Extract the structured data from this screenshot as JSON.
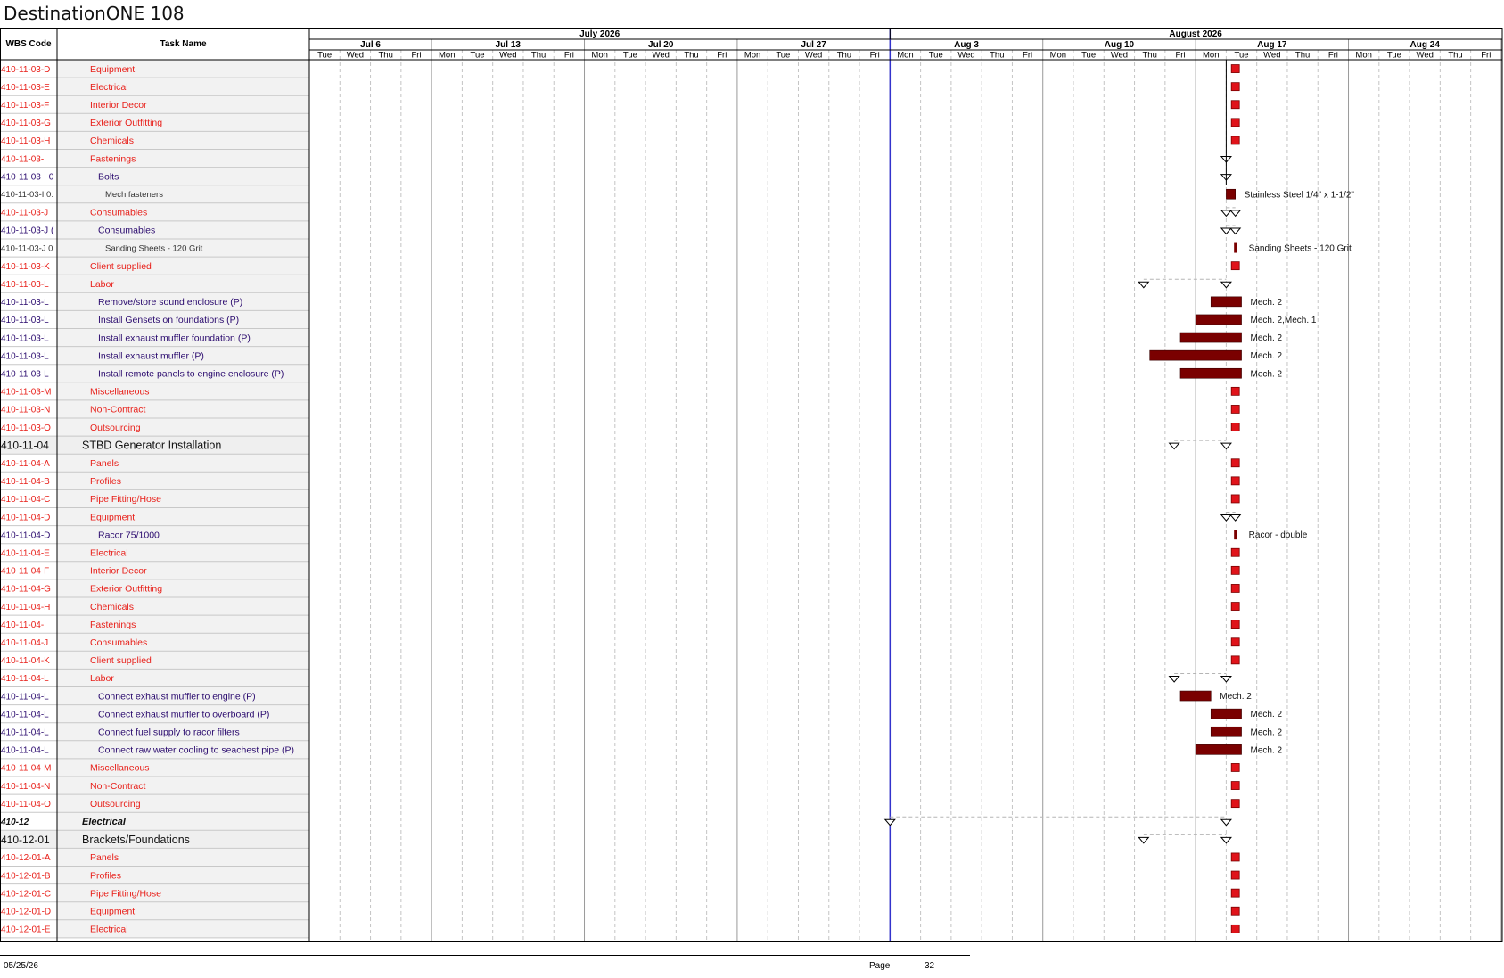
{
  "title": "DestinationONE 108",
  "headers": {
    "wbs": "WBS Code",
    "task": "Task Name"
  },
  "timeline": {
    "months": [
      {
        "label": "July 2026"
      },
      {
        "label": "August 2026"
      }
    ],
    "weeks": [
      "Jul 6",
      "Jul 13",
      "Jul 20",
      "Jul 27",
      "Aug 3",
      "Aug 10",
      "Aug 17",
      "Aug 24"
    ],
    "day_labels": [
      "Tue",
      "Wed",
      "Thu",
      "Fri",
      "Mon",
      "Tue",
      "Wed",
      "Thu",
      "Fri",
      "Mon",
      "Tue",
      "Wed",
      "Thu",
      "Fri",
      "Mon",
      "Tue",
      "Wed",
      "Thu",
      "Fri",
      "Mon",
      "Tue",
      "Wed",
      "Thu",
      "Fri",
      "Mon",
      "Tue",
      "Wed",
      "Thu",
      "Fri",
      "Mon",
      "Tue",
      "Wed",
      "Thu",
      "Fri",
      "Mon",
      "Tue",
      "Wed",
      "Thu",
      "Fri"
    ],
    "week_day_ranges": [
      [
        0,
        3
      ],
      [
        4,
        8
      ],
      [
        9,
        13
      ],
      [
        14,
        18
      ],
      [
        19,
        23
      ],
      [
        24,
        28
      ],
      [
        29,
        33
      ],
      [
        34,
        38
      ]
    ],
    "status_date_index": 19
  },
  "colors": {
    "red_text": "#e8201a",
    "purple_text": "#2a0a6e",
    "gray_text": "#333333",
    "bar_fill": "#7a0000",
    "milestone_fill": "#e0131a",
    "status_line": "#3333cc",
    "row_band": "#f2f2f2"
  },
  "rows": [
    {
      "wbs": "410-11-03-D",
      "name": "Equipment",
      "style": "red",
      "indent": 1,
      "bar": {
        "kind": "milestone",
        "day": 30.3
      }
    },
    {
      "wbs": "410-11-03-E",
      "name": "Electrical",
      "style": "red",
      "indent": 1,
      "bar": {
        "kind": "milestone",
        "day": 30.3
      }
    },
    {
      "wbs": "410-11-03-F",
      "name": "Interior Decor",
      "style": "red",
      "indent": 1,
      "bar": {
        "kind": "milestone",
        "day": 30.3
      }
    },
    {
      "wbs": "410-11-03-G",
      "name": "Exterior Outfitting",
      "style": "red",
      "indent": 1,
      "bar": {
        "kind": "milestone",
        "day": 30.3
      }
    },
    {
      "wbs": "410-11-03-H",
      "name": "Chemicals",
      "style": "red",
      "indent": 1,
      "bar": {
        "kind": "milestone",
        "day": 30.3
      }
    },
    {
      "wbs": "410-11-03-I",
      "name": "Fastenings",
      "style": "red",
      "indent": 1,
      "bar": {
        "kind": "summary",
        "start": 30,
        "end": 30
      }
    },
    {
      "wbs": "410-11-03-I 0",
      "name": "Bolts",
      "style": "purple",
      "indent": 2,
      "bar": {
        "kind": "summary",
        "start": 30,
        "end": 30
      }
    },
    {
      "wbs": "410-11-03-I 0:",
      "name": "Mech fasteners",
      "style": "gray",
      "indent": 3,
      "bar": {
        "kind": "task",
        "start": 30,
        "end": 30.3,
        "label": "Stainless Steel 1/4\" x 1-1/2\""
      }
    },
    {
      "wbs": "410-11-03-J",
      "name": "Consumables",
      "style": "red",
      "indent": 1,
      "bar": {
        "kind": "summary",
        "start": 30,
        "end": 30.3
      }
    },
    {
      "wbs": "410-11-03-J (",
      "name": "Consumables",
      "style": "purple",
      "indent": 2,
      "bar": {
        "kind": "summary",
        "start": 30,
        "end": 30.3
      }
    },
    {
      "wbs": "410-11-03-J 0",
      "name": "Sanding Sheets - 120 Grit",
      "style": "gray",
      "indent": 3,
      "bar": {
        "kind": "thin",
        "day": 30.3,
        "label": "Sanding Sheets - 120 Grit"
      }
    },
    {
      "wbs": "410-11-03-K",
      "name": "Client supplied",
      "style": "red",
      "indent": 1,
      "bar": {
        "kind": "milestone",
        "day": 30.3
      }
    },
    {
      "wbs": "410-11-03-L",
      "name": "Labor",
      "style": "red",
      "indent": 1,
      "bar": {
        "kind": "summary",
        "start": 27.3,
        "end": 30
      }
    },
    {
      "wbs": "410-11-03-L",
      "name": "Remove/store sound enclosure (P)",
      "style": "purple",
      "indent": 2,
      "bar": {
        "kind": "task",
        "start": 29.5,
        "end": 30.5,
        "label": "Mech. 2"
      }
    },
    {
      "wbs": "410-11-03-L",
      "name": "Install Gensets on foundations (P)",
      "style": "purple",
      "indent": 2,
      "bar": {
        "kind": "task",
        "start": 29,
        "end": 30.5,
        "label": "Mech. 2,Mech. 1"
      }
    },
    {
      "wbs": "410-11-03-L",
      "name": "Install exhaust muffler foundation (P)",
      "style": "purple",
      "indent": 2,
      "bar": {
        "kind": "task",
        "start": 28.5,
        "end": 30.5,
        "label": "Mech. 2"
      }
    },
    {
      "wbs": "410-11-03-L",
      "name": "Install exhaust muffler (P)",
      "style": "purple",
      "indent": 2,
      "bar": {
        "kind": "task",
        "start": 27.5,
        "end": 30.5,
        "label": "Mech. 2"
      }
    },
    {
      "wbs": "410-11-03-L",
      "name": "Install remote panels to engine enclosure (P)",
      "style": "purple",
      "indent": 2,
      "bar": {
        "kind": "task",
        "start": 28.5,
        "end": 30.5,
        "label": "Mech. 2"
      }
    },
    {
      "wbs": "410-11-03-M",
      "name": "Miscellaneous",
      "style": "red",
      "indent": 1,
      "bar": {
        "kind": "milestone",
        "day": 30.3
      }
    },
    {
      "wbs": "410-11-03-N",
      "name": "Non-Contract",
      "style": "red",
      "indent": 1,
      "bar": {
        "kind": "milestone",
        "day": 30.3
      }
    },
    {
      "wbs": "410-11-03-O",
      "name": "Outsourcing",
      "style": "red",
      "indent": 1,
      "bar": {
        "kind": "milestone",
        "day": 30.3
      }
    },
    {
      "wbs": "410-11-04",
      "name": "STBD Generator Installation",
      "style": "section",
      "indent": 0,
      "bar": {
        "kind": "summary",
        "start": 28.3,
        "end": 30
      }
    },
    {
      "wbs": "410-11-04-A",
      "name": "Panels",
      "style": "red",
      "indent": 1,
      "bar": {
        "kind": "milestone",
        "day": 30.3
      }
    },
    {
      "wbs": "410-11-04-B",
      "name": "Profiles",
      "style": "red",
      "indent": 1,
      "bar": {
        "kind": "milestone",
        "day": 30.3
      }
    },
    {
      "wbs": "410-11-04-C",
      "name": "Pipe Fitting/Hose",
      "style": "red",
      "indent": 1,
      "bar": {
        "kind": "milestone",
        "day": 30.3
      }
    },
    {
      "wbs": "410-11-04-D",
      "name": "Equipment",
      "style": "red",
      "indent": 1,
      "bar": {
        "kind": "summary",
        "start": 30,
        "end": 30.3
      }
    },
    {
      "wbs": "410-11-04-D",
      "name": "Racor 75/1000",
      "style": "purple",
      "indent": 2,
      "bar": {
        "kind": "thin",
        "day": 30.3,
        "label": "Racor - double"
      }
    },
    {
      "wbs": "410-11-04-E",
      "name": "Electrical",
      "style": "red",
      "indent": 1,
      "bar": {
        "kind": "milestone",
        "day": 30.3
      }
    },
    {
      "wbs": "410-11-04-F",
      "name": "Interior Decor",
      "style": "red",
      "indent": 1,
      "bar": {
        "kind": "milestone",
        "day": 30.3
      }
    },
    {
      "wbs": "410-11-04-G",
      "name": "Exterior Outfitting",
      "style": "red",
      "indent": 1,
      "bar": {
        "kind": "milestone",
        "day": 30.3
      }
    },
    {
      "wbs": "410-11-04-H",
      "name": "Chemicals",
      "style": "red",
      "indent": 1,
      "bar": {
        "kind": "milestone",
        "day": 30.3
      }
    },
    {
      "wbs": "410-11-04-I",
      "name": "Fastenings",
      "style": "red",
      "indent": 1,
      "bar": {
        "kind": "milestone",
        "day": 30.3
      }
    },
    {
      "wbs": "410-11-04-J",
      "name": "Consumables",
      "style": "red",
      "indent": 1,
      "bar": {
        "kind": "milestone",
        "day": 30.3
      }
    },
    {
      "wbs": "410-11-04-K",
      "name": "Client supplied",
      "style": "red",
      "indent": 1,
      "bar": {
        "kind": "milestone",
        "day": 30.3
      }
    },
    {
      "wbs": "410-11-04-L",
      "name": "Labor",
      "style": "red",
      "indent": 1,
      "bar": {
        "kind": "summary",
        "start": 28.3,
        "end": 30
      }
    },
    {
      "wbs": "410-11-04-L",
      "name": "Connect exhaust muffler to engine (P)",
      "style": "purple",
      "indent": 2,
      "bar": {
        "kind": "task",
        "start": 28.5,
        "end": 29.5,
        "label": "Mech. 2"
      }
    },
    {
      "wbs": "410-11-04-L",
      "name": "Connect exhaust muffler to overboard (P)",
      "style": "purple",
      "indent": 2,
      "bar": {
        "kind": "task",
        "start": 29.5,
        "end": 30.5,
        "label": "Mech. 2"
      }
    },
    {
      "wbs": "410-11-04-L",
      "name": "Connect fuel supply to racor filters",
      "style": "purple",
      "indent": 2,
      "bar": {
        "kind": "task",
        "start": 29.5,
        "end": 30.5,
        "label": "Mech. 2"
      }
    },
    {
      "wbs": "410-11-04-L",
      "name": "Connect raw water cooling to seachest pipe (P)",
      "style": "purple",
      "indent": 2,
      "bar": {
        "kind": "task",
        "start": 29,
        "end": 30.5,
        "label": "Mech. 2"
      }
    },
    {
      "wbs": "410-11-04-M",
      "name": "Miscellaneous",
      "style": "red",
      "indent": 1,
      "bar": {
        "kind": "milestone",
        "day": 30.3
      }
    },
    {
      "wbs": "410-11-04-N",
      "name": "Non-Contract",
      "style": "red",
      "indent": 1,
      "bar": {
        "kind": "milestone",
        "day": 30.3
      }
    },
    {
      "wbs": "410-11-04-O",
      "name": "Outsourcing",
      "style": "red",
      "indent": 1,
      "bar": {
        "kind": "milestone",
        "day": 30.3
      }
    },
    {
      "wbs": "410-12",
      "name": "Electrical",
      "style": "bold-italic",
      "indent": 0,
      "bar": {
        "kind": "summary",
        "start": 19,
        "end": 30
      }
    },
    {
      "wbs": "410-12-01",
      "name": "Brackets/Foundations",
      "style": "section",
      "indent": 0,
      "bar": {
        "kind": "summary",
        "start": 27.3,
        "end": 30
      }
    },
    {
      "wbs": "410-12-01-A",
      "name": "Panels",
      "style": "red",
      "indent": 1,
      "bar": {
        "kind": "milestone",
        "day": 30.3
      }
    },
    {
      "wbs": "410-12-01-B",
      "name": "Profiles",
      "style": "red",
      "indent": 1,
      "bar": {
        "kind": "milestone",
        "day": 30.3
      }
    },
    {
      "wbs": "410-12-01-C",
      "name": "Pipe Fitting/Hose",
      "style": "red",
      "indent": 1,
      "bar": {
        "kind": "milestone",
        "day": 30.3
      }
    },
    {
      "wbs": "410-12-01-D",
      "name": "Equipment",
      "style": "red",
      "indent": 1,
      "bar": {
        "kind": "milestone",
        "day": 30.3
      }
    },
    {
      "wbs": "410-12-01-E",
      "name": "Electrical",
      "style": "red",
      "indent": 1,
      "bar": {
        "kind": "milestone",
        "day": 30.3
      }
    }
  ],
  "footer": {
    "date": "05/25/26",
    "page_label": "Page",
    "page_number": "32"
  }
}
